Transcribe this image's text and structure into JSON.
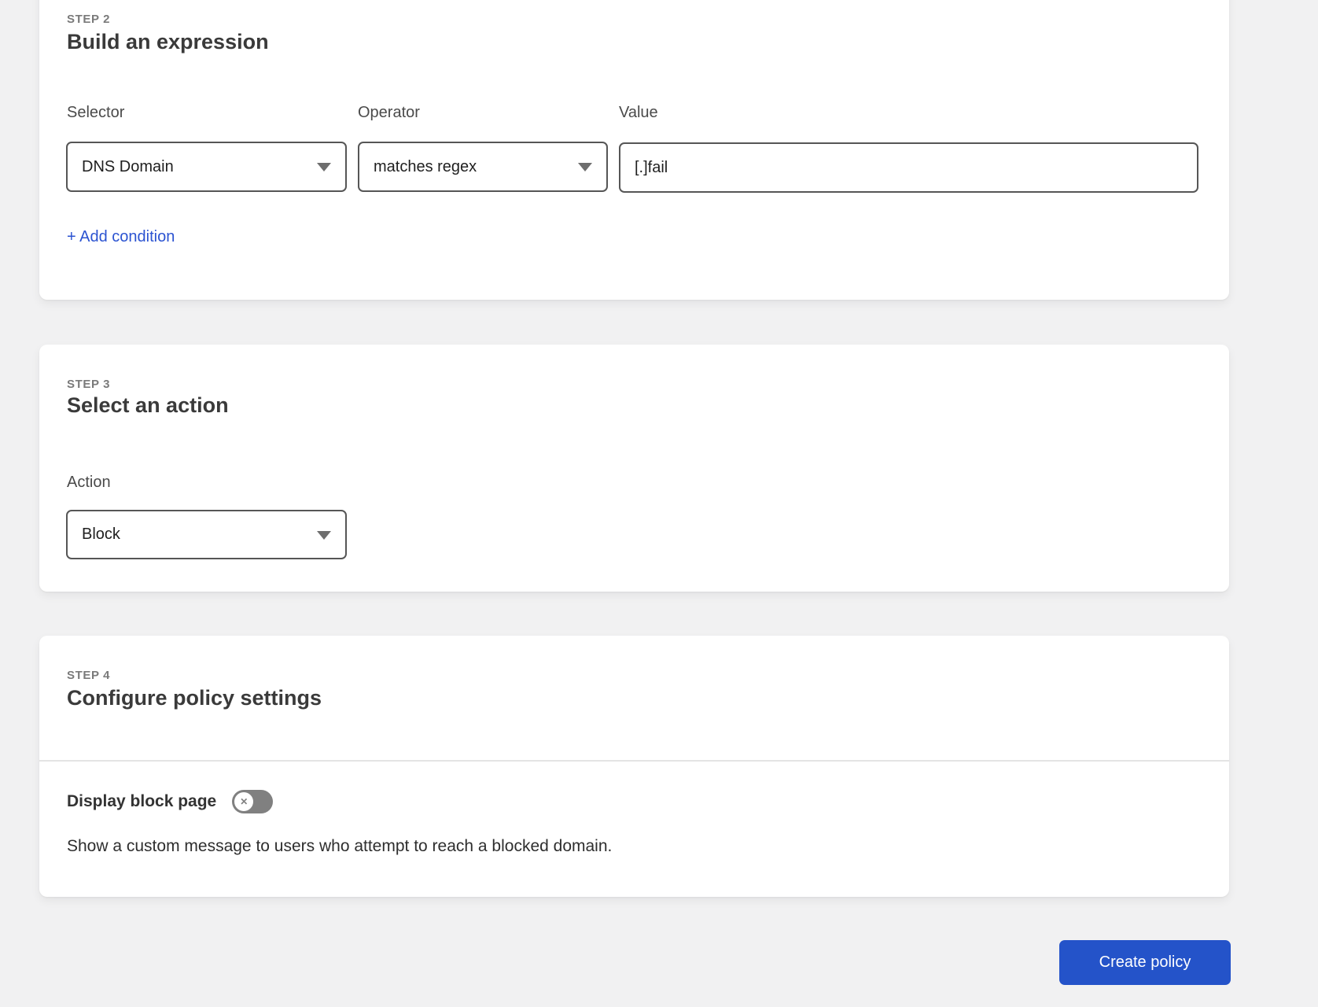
{
  "steps": {
    "step2": {
      "step_label": "STEP 2",
      "title": "Build an expression",
      "fields": {
        "selector": {
          "label": "Selector",
          "value": "DNS Domain"
        },
        "operator": {
          "label": "Operator",
          "value": "matches regex"
        },
        "value": {
          "label": "Value",
          "value": "[.]fail"
        }
      },
      "add_condition_label": "+ Add condition"
    },
    "step3": {
      "step_label": "STEP 3",
      "title": "Select an action",
      "action": {
        "label": "Action",
        "value": "Block"
      }
    },
    "step4": {
      "step_label": "STEP 4",
      "title": "Configure policy settings",
      "display_block_page": {
        "label": "Display block page",
        "state": "off",
        "description": "Show a custom message to users who attempt to reach a blocked domain."
      }
    }
  },
  "footer": {
    "create_policy_label": "Create policy"
  },
  "icons": {
    "dropdown_icon": "chevron-down-icon",
    "toggle_off_icon": "x-icon",
    "toggle_x_glyph": "✕"
  },
  "colors": {
    "link_blue": "#2b53d1",
    "button_blue": "#2453c9",
    "toggle_off_gray": "#808080",
    "page_background": "#f1f1f2"
  }
}
